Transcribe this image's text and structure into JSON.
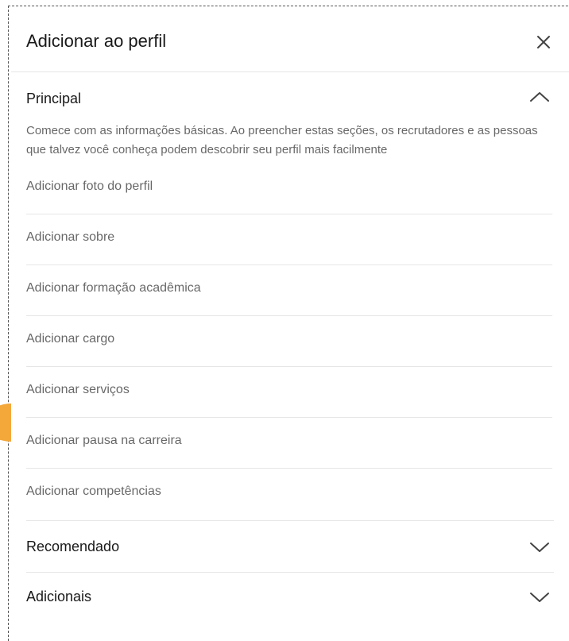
{
  "modal": {
    "title": "Adicionar ao perfil",
    "close_icon": "close-icon"
  },
  "sections": {
    "principal": {
      "title": "Principal",
      "expanded": true,
      "chevron": "chevron-up-icon",
      "description": "Comece com as informações básicas. Ao preencher estas seções, os recrutadores e as pessoas que talvez você conheça podem descobrir seu perfil mais facilmente",
      "items": [
        "Adicionar foto do perfil",
        "Adicionar sobre",
        "Adicionar formação acadêmica",
        "Adicionar cargo",
        "Adicionar serviços",
        "Adicionar pausa na carreira",
        "Adicionar competências"
      ]
    },
    "recomendado": {
      "title": "Recomendado",
      "expanded": false,
      "chevron": "chevron-down-icon"
    },
    "adicionais": {
      "title": "Adicionais",
      "expanded": false,
      "chevron": "chevron-down-icon"
    }
  },
  "colors": {
    "text_primary": "#1a1a1a",
    "text_secondary": "#666666",
    "divider": "#e6e6e6",
    "pointer_accent": "#f4a83a"
  }
}
